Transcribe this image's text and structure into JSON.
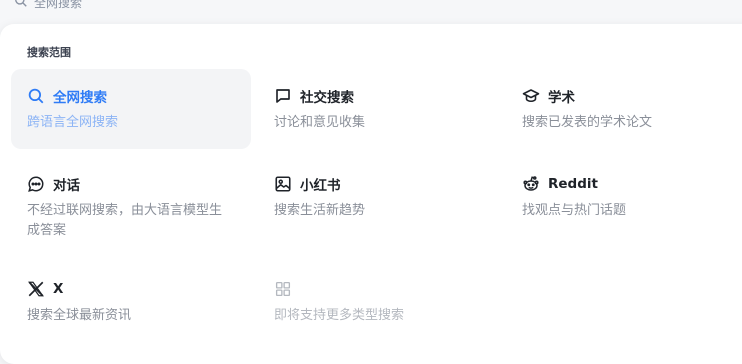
{
  "search": {
    "label": "全网搜索"
  },
  "panel": {
    "section_title": "搜索范围"
  },
  "options": [
    {
      "title": "全网搜索",
      "desc": "跨语言全网搜索",
      "icon": "search-icon",
      "active": true
    },
    {
      "title": "社交搜索",
      "desc": "讨论和意见收集",
      "icon": "chat-bubble-icon"
    },
    {
      "title": "学术",
      "desc": "搜索已发表的学术论文",
      "icon": "graduation-cap-icon"
    },
    {
      "title": "对话",
      "desc": "不经过联网搜索，由大语言模型生成答案",
      "icon": "message-dots-icon"
    },
    {
      "title": "小红书",
      "desc": "搜索生活新趋势",
      "icon": "image-frame-icon"
    },
    {
      "title": "Reddit",
      "desc": "找观点与热门话题",
      "icon": "reddit-icon"
    },
    {
      "title": "X",
      "desc": "搜索全球最新资讯",
      "icon": "x-logo-icon"
    },
    {
      "title": "",
      "desc": "即将支持更多类型搜索",
      "icon": "grid-icon",
      "disabled": true
    }
  ],
  "colors": {
    "accent": "#2f7cf6",
    "active_bg": "#f3f4f6"
  }
}
